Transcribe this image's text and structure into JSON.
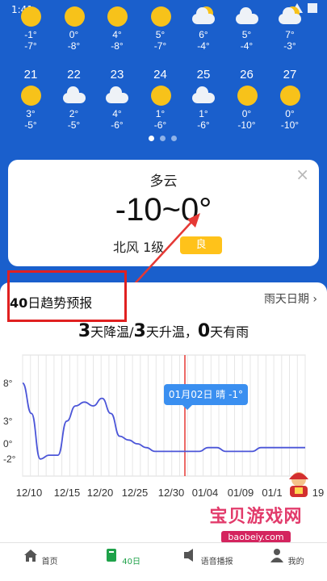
{
  "status_bar": {
    "time": "1:41"
  },
  "forecast_row1": [
    {
      "weather": "sunny",
      "high": "-1°",
      "low": "-7°"
    },
    {
      "weather": "sunny",
      "high": "0°",
      "low": "-8°"
    },
    {
      "weather": "sunny",
      "high": "4°",
      "low": "-8°"
    },
    {
      "weather": "sunny",
      "high": "5°",
      "low": "-7°"
    },
    {
      "weather": "partly-cloudy",
      "high": "6°",
      "low": "-4°"
    },
    {
      "weather": "cloudy",
      "high": "5°",
      "low": "-4°"
    },
    {
      "weather": "partly-cloudy",
      "high": "7°",
      "low": "-3°"
    }
  ],
  "forecast_row2": [
    {
      "date": "21",
      "weather": "sunny",
      "high": "3°",
      "low": "-5°"
    },
    {
      "date": "22",
      "weather": "cloudy",
      "high": "2°",
      "low": "-5°"
    },
    {
      "date": "23",
      "weather": "cloudy",
      "high": "4°",
      "low": "-6°"
    },
    {
      "date": "24",
      "weather": "sunny",
      "high": "1°",
      "low": "-6°"
    },
    {
      "date": "25",
      "weather": "cloudy",
      "high": "1°",
      "low": "-6°"
    },
    {
      "date": "26",
      "weather": "sunny",
      "high": "0°",
      "low": "-10°"
    },
    {
      "date": "27",
      "weather": "sunny",
      "high": "0°",
      "low": "-10°"
    }
  ],
  "card": {
    "condition": "多云",
    "temp_range": "-10~0°",
    "wind": "北风 1级",
    "aqi": "良",
    "close": "×"
  },
  "trend": {
    "title_bold": "40",
    "title_rest": "日趋势预报",
    "rain_link": "雨天日期",
    "chevron": "›",
    "summary": {
      "down_n": "3",
      "down_txt": "天降温/",
      "up_n": "3",
      "up_txt": "天升温，",
      "rain_n": "0",
      "rain_txt": "天有雨"
    },
    "tooltip": "01月02日 晴 -1°"
  },
  "chart_data": {
    "type": "line",
    "y_tick_labels": [
      "8°",
      "3°",
      "0°",
      "-2°"
    ],
    "x_tick_labels": [
      "12/10",
      "12/15",
      "12/20",
      "12/25",
      "12/30",
      "01/04",
      "01/09",
      "01/1",
      "19"
    ],
    "series": [
      {
        "values": [
          8,
          4,
          -2,
          -1.5,
          -1.5,
          3,
          5,
          5.5,
          5,
          6,
          4,
          1,
          0.5,
          0,
          -0.5,
          -1,
          -1,
          -1,
          -1,
          -1,
          -1,
          -0.5,
          -0.5,
          -1,
          -1,
          -1,
          -1,
          -0.5,
          -0.5,
          -0.5,
          -0.5,
          -0.5,
          -0.5
        ]
      }
    ],
    "highlight_date": "01/02"
  },
  "tabbar": {
    "items": [
      {
        "label": "首页",
        "icon": "home-icon"
      },
      {
        "label": "40日",
        "icon": "book-icon"
      },
      {
        "label": "语音播报",
        "icon": "speaker-icon"
      },
      {
        "label": "我的",
        "icon": "user-icon"
      }
    ]
  },
  "watermark": {
    "text": "宝贝游戏网",
    "url": "baobeiy.com"
  },
  "colors": {
    "brand_blue": "#1a5fcc",
    "sun": "#f7c21a",
    "aqi": "#ffc21a",
    "highlight_line": "#e53935",
    "series": "#4b55d8",
    "tooltip": "#3a8ff0",
    "annotation": "#e02020",
    "tab_active": "#1fa24a"
  }
}
